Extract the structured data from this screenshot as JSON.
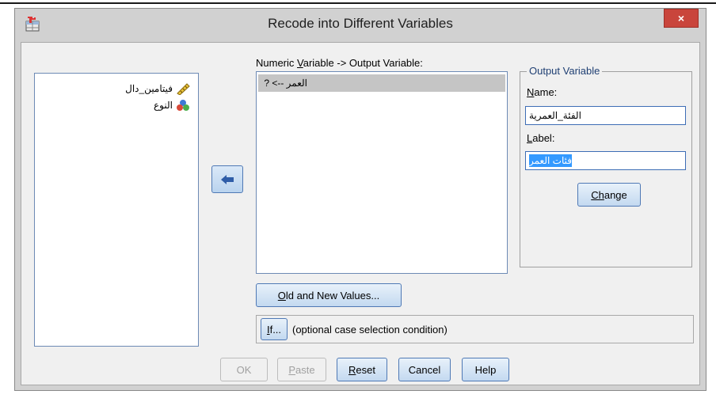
{
  "window": {
    "title": "Recode into Different Variables",
    "close_glyph": "×"
  },
  "source_list": {
    "items": [
      {
        "label": "فيتامين_دال",
        "icon": "scale-ruler-icon"
      },
      {
        "label": "النوع",
        "icon": "nominal-balls-icon"
      }
    ]
  },
  "mapping": {
    "header_prefix": "Numeric ",
    "header_mnemonic": "V",
    "header_suffix": "ariable -> Output Variable:",
    "rows": [
      "العمر --> ?"
    ]
  },
  "output_group": {
    "title": "Output Variable",
    "name_label_mnemonic": "N",
    "name_label_rest": "ame:",
    "name_value": "الفئة_العمرية",
    "label_label_mnemonic": "L",
    "label_label_rest": "abel:",
    "label_value": "فئات العمر",
    "change_mnemonic": "Ch",
    "change_rest": "ange"
  },
  "buttons": {
    "old_new_mnemonic": "O",
    "old_new_rest": "ld and New Values...",
    "if_mnemonic": "I",
    "if_rest": "f...",
    "if_caption": "(optional case selection condition)",
    "ok": "OK",
    "paste_mnemonic": "P",
    "paste_rest": "aste",
    "reset_mnemonic": "R",
    "reset_rest": "eset",
    "cancel": "Cancel",
    "help": "Help"
  },
  "colors": {
    "selection_highlight": "#3399ff",
    "button_border": "#4f79b5",
    "close_button": "#c9453c"
  }
}
